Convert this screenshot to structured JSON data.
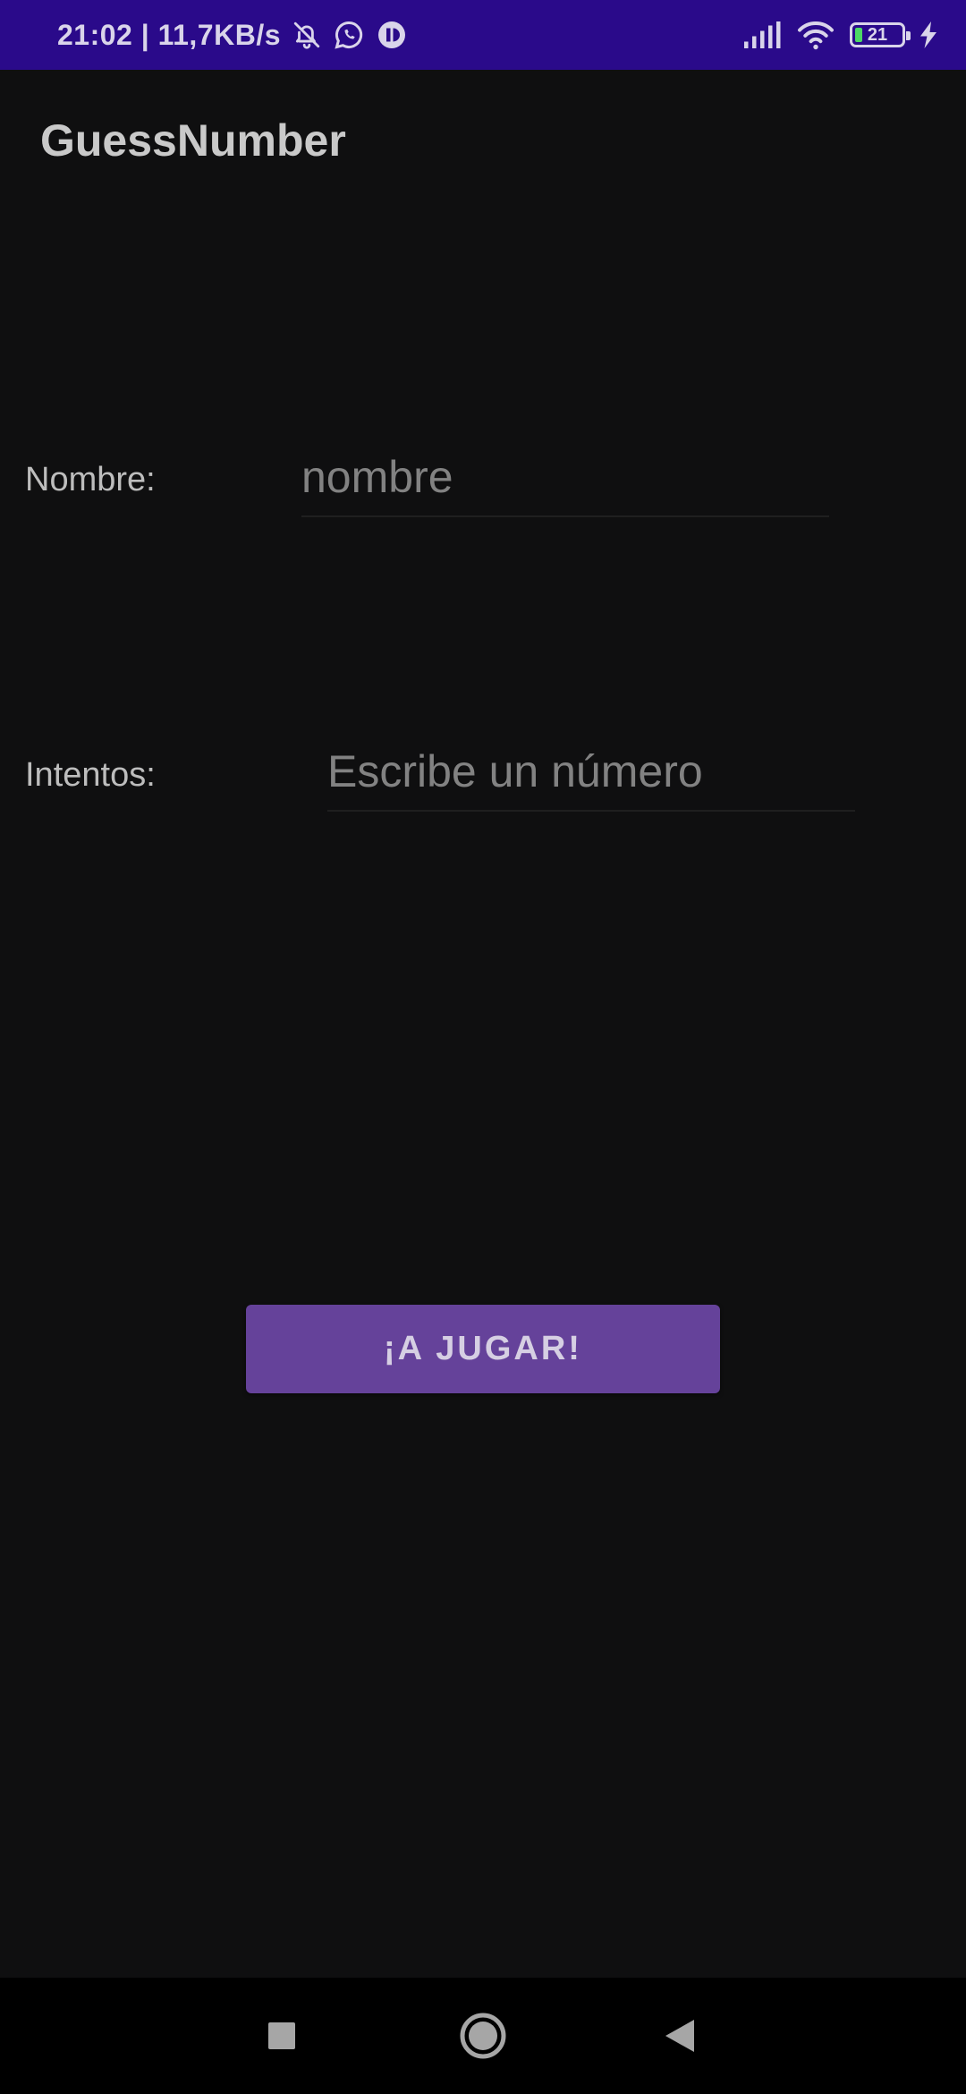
{
  "status_bar": {
    "time_and_speed": "21:02 | 11,7KB/s",
    "battery_level": "21",
    "icons": [
      "bell-off-icon",
      "whatsapp-icon",
      "app-notification-icon",
      "signal-icon",
      "wifi-icon",
      "battery-icon",
      "charging-icon"
    ]
  },
  "app": {
    "title": "GuessNumber"
  },
  "form": {
    "name_label": "Nombre:",
    "name_placeholder": "nombre",
    "attempts_label": "Intentos:",
    "attempts_placeholder": "Escribe un número"
  },
  "actions": {
    "play_label": "¡A JUGAR!"
  },
  "colors": {
    "status_bar": "#2a0a8a",
    "background": "#0f0f10",
    "button": "#65429a"
  },
  "nav_bar": {
    "icons": [
      "recents-icon",
      "home-icon",
      "back-icon"
    ]
  }
}
